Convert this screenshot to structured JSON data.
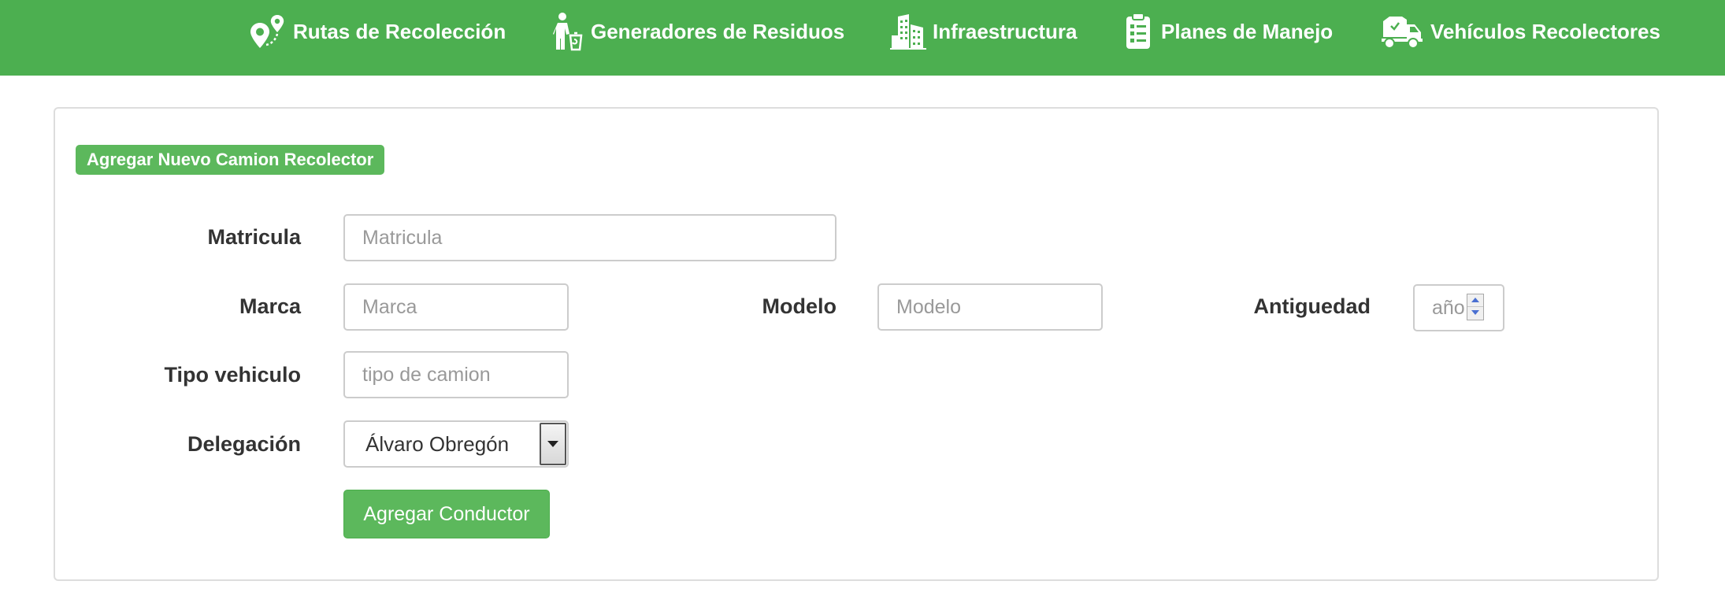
{
  "nav": {
    "items": [
      {
        "label": "Rutas de Recolección",
        "icon": "map-pin-route-icon"
      },
      {
        "label": "Generadores de Residuos",
        "icon": "person-trash-icon"
      },
      {
        "label": "Infraestructura",
        "icon": "buildings-icon"
      },
      {
        "label": "Planes de Manejo",
        "icon": "clipboard-checklist-icon"
      },
      {
        "label": "Vehículos Recolectores",
        "icon": "garbage-truck-icon"
      }
    ]
  },
  "form": {
    "badge": "Agregar Nuevo Camion Recolector",
    "matricula": {
      "label": "Matricula",
      "placeholder": "Matricula"
    },
    "marca": {
      "label": "Marca",
      "placeholder": "Marca"
    },
    "modelo": {
      "label": "Modelo",
      "placeholder": "Modelo"
    },
    "antiguedad": {
      "label": "Antiguedad",
      "placeholder": "año"
    },
    "tipo": {
      "label": "Tipo vehiculo",
      "placeholder": "tipo de camion"
    },
    "delegacion": {
      "label": "Delegación",
      "selected": "Álvaro Obregón"
    },
    "submit_label": "Agregar Conductor"
  },
  "colors": {
    "navbar": "#4caf50",
    "accent": "#5cb85c"
  }
}
